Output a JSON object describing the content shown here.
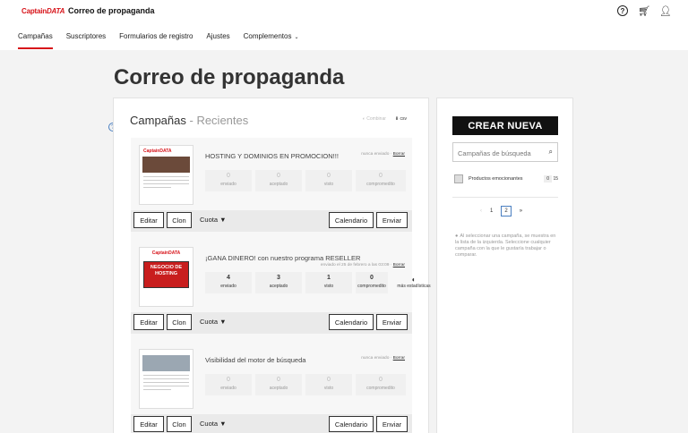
{
  "brand": {
    "logo_a": "Captain",
    "logo_b": "DATA",
    "app_title": "Correo de propaganda"
  },
  "top_icons": [
    "help-icon",
    "cart-icon",
    "user-icon"
  ],
  "nav": [
    {
      "label": "Campañas",
      "active": true
    },
    {
      "label": "Suscriptores"
    },
    {
      "label": "Formularios de registro"
    },
    {
      "label": "Ajustes"
    },
    {
      "label": "Complementos",
      "caret": "⌄"
    }
  ],
  "page_title": "Correo de propaganda",
  "panel": {
    "title": "Campañas",
    "separator": " - ",
    "subtitle": "Recientes",
    "combine": "Combinar",
    "csv": "csv"
  },
  "campaigns": [
    {
      "title": "HOSTING Y DOMINIOS EN PROMOCION!!!",
      "status": "nunca enviado",
      "delete": "Borrar",
      "stats": [
        {
          "v": "0",
          "l": "enviado"
        },
        {
          "v": "0",
          "l": "aceptado"
        },
        {
          "v": "0",
          "l": "visto"
        },
        {
          "v": "0",
          "l": "compromedito"
        }
      ]
    },
    {
      "title": "¡GANA DINERO! con nuestro programa RESELLER",
      "status": "enviado el 25 de febrero a las 03:09",
      "delete": "Borrar",
      "thumb_text": "NEGOCIO DE HOSTING",
      "stats": [
        {
          "v": "4",
          "l": "enviado"
        },
        {
          "v": "3",
          "l": "aceptado"
        },
        {
          "v": "1",
          "l": "visto"
        },
        {
          "v": "0",
          "l": "compromedito"
        }
      ],
      "more": "más estadísticas"
    },
    {
      "title": "Visibilidad del motor de búsqueda",
      "status": "nunca enviado",
      "delete": "Borrar",
      "stats": [
        {
          "v": "0",
          "l": "enviado"
        },
        {
          "v": "0",
          "l": "aceptado"
        },
        {
          "v": "0",
          "l": "visto"
        },
        {
          "v": "0",
          "l": "compromedito"
        }
      ]
    }
  ],
  "buttons": {
    "edit": "Editar",
    "clone": "Clon",
    "quota": "Cuota",
    "calendar": "Calendario",
    "send": "Enviar"
  },
  "side": {
    "create": "CREAR NUEVA",
    "search_placeholder": "Campañas de búsqueda",
    "item_label": "Productos emocionantes",
    "item_count_a": "0",
    "item_count_b": "15",
    "pager": [
      "‹",
      "1",
      "2",
      "»"
    ],
    "note": "Al seleccionar una campaña, se muestra en la lista de la izquierda. Seleccione cualquier campaña con la que le gustaría trabajar o comparar."
  },
  "colors": {
    "accent": "#d7141a",
    "link": "#4a7fc1"
  }
}
